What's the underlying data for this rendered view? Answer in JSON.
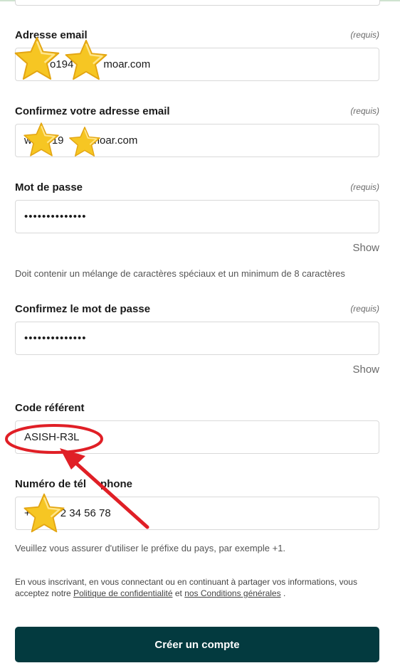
{
  "form": {
    "email": {
      "label": "Adresse email",
      "required": "(requis)",
      "value_a": "",
      "value_b": "o194",
      "value_c": "moar.com"
    },
    "email_confirm": {
      "label": "Confirmez votre adresse email",
      "required": "(requis)",
      "value_a": "w",
      "value_b": "19",
      "value_c": "moar.com"
    },
    "password": {
      "label": "Mot de passe",
      "required": "(requis)",
      "value": "••••••••••••••",
      "show_label": "Show",
      "hint": "Doit contenir un mélange de caractères spéciaux et un minimum de 8 caractères"
    },
    "password_confirm": {
      "label": "Confirmez le mot de passe",
      "required": "(requis)",
      "value": "••••••••••••••",
      "show_label": "Show"
    },
    "referral": {
      "label": "Code référent",
      "value": "ASISH-R3L"
    },
    "phone": {
      "label_a": "Numéro de tél",
      "label_b": "phone",
      "value_prefix": "+",
      "value": "2 34 56 78",
      "hint": "Veuillez vous assurer d'utiliser le préfixe du pays, par exemple +1."
    }
  },
  "legal": {
    "text_before": "En vous inscrivant, en vous connectant ou en continuant à partager vos informations, vous acceptez notre ",
    "privacy_link": "Politique de confidentialité",
    "text_middle": " et ",
    "terms_link": "nos Conditions générales",
    "text_after": " ."
  },
  "submit_label": "Créer un compte",
  "colors": {
    "button": "#033a3f",
    "annotation": "#e01f26",
    "star": "#f6c623"
  },
  "icons": [
    "star-sticker-icon",
    "annotation-arrow-icon",
    "annotation-circle-icon"
  ]
}
